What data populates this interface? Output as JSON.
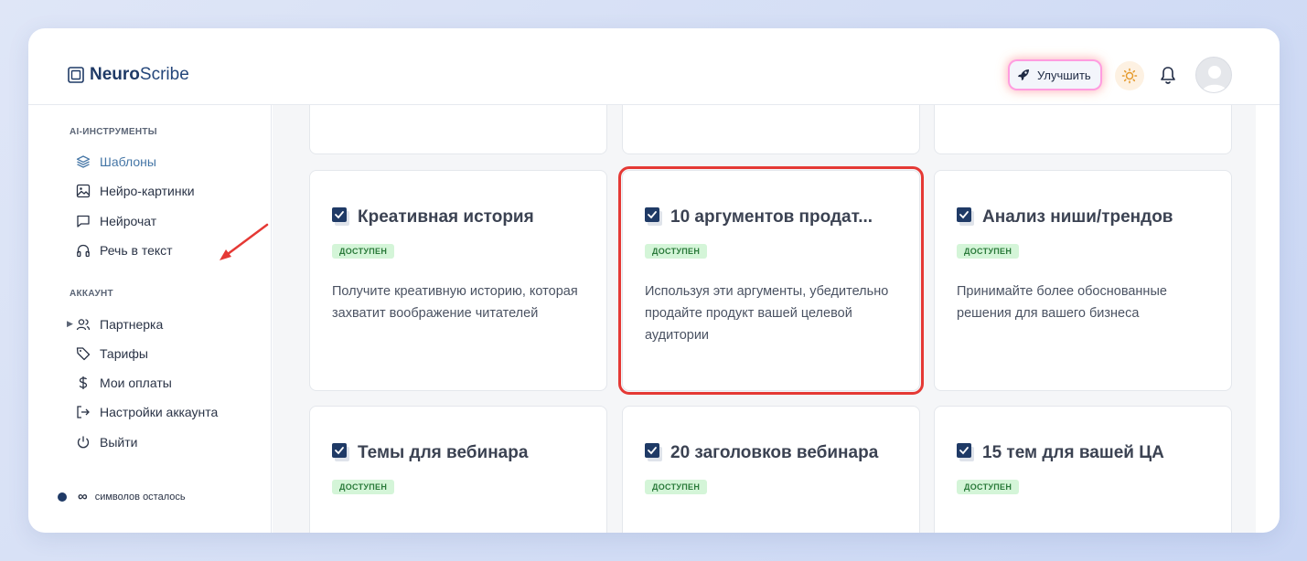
{
  "app": {
    "logo_bold": "Neuro",
    "logo_light": "Scribe"
  },
  "header": {
    "upgrade_label": "Улучшить",
    "icons": [
      "rocket-icon",
      "sun-icon",
      "bell-icon",
      "avatar"
    ]
  },
  "sidebar": {
    "section_tools": "AI-ИНСТРУМЕНТЫ",
    "tools": [
      {
        "label": "Шаблоны",
        "icon": "layers-icon",
        "active": true
      },
      {
        "label": "Нейро-картинки",
        "icon": "image-icon"
      },
      {
        "label": "Нейрочат",
        "icon": "chat-icon"
      },
      {
        "label": "Речь в текст",
        "icon": "headphones-icon"
      }
    ],
    "section_account": "АККАУНТ",
    "account": [
      {
        "label": "Партнерка",
        "icon": "users-icon",
        "expandable": true
      },
      {
        "label": "Тарифы",
        "icon": "tag-icon"
      },
      {
        "label": "Мои оплаты",
        "icon": "dollar-icon"
      },
      {
        "label": "Настройки аккаунта",
        "icon": "logout-icon"
      },
      {
        "label": "Выйти",
        "icon": "power-icon"
      }
    ],
    "credits_symbol": "∞",
    "credits_text": "символов осталось"
  },
  "cards": [
    {
      "title": "Креативная история",
      "badge": "ДОСТУПЕН",
      "desc": "Получите креативную историю, которая захватит воображение читателей"
    },
    {
      "title": "10 аргументов продат...",
      "badge": "ДОСТУПЕН",
      "desc": "Используя эти аргументы, убедительно продайте продукт вашей целевой аудитории",
      "highlighted": true
    },
    {
      "title": "Анализ ниши/трендов",
      "badge": "ДОСТУПЕН",
      "desc": "Принимайте более обоснованные решения для вашего бизнеса"
    },
    {
      "title": "Темы для вебинара",
      "badge": "ДОСТУПЕН",
      "desc": ""
    },
    {
      "title": "20 заголовков вебинара",
      "badge": "ДОСТУПЕН",
      "desc": ""
    },
    {
      "title": "15 тем для вашей ЦА",
      "badge": "ДОСТУПЕН",
      "desc": ""
    }
  ],
  "colors": {
    "accent": "#4576a6",
    "brand": "#1f3a66",
    "badge_bg": "#d4f5d8",
    "badge_text": "#2a7a3a",
    "highlight": "#e53935"
  }
}
